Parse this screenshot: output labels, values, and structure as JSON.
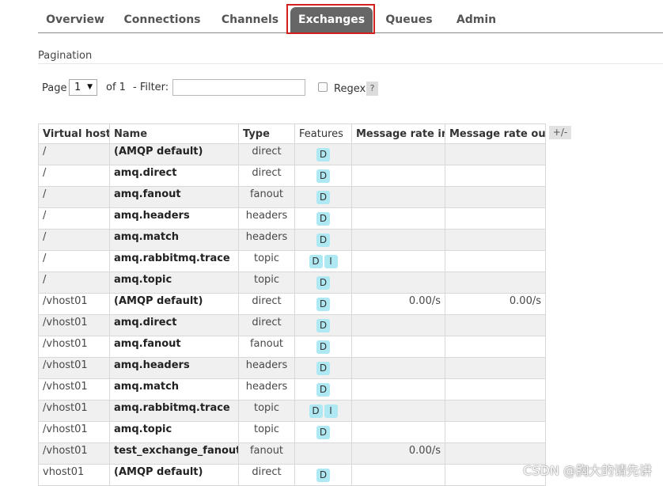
{
  "nav": {
    "tabs": [
      {
        "label": "Overview"
      },
      {
        "label": "Connections"
      },
      {
        "label": "Channels"
      },
      {
        "label": "Exchanges",
        "active": true
      },
      {
        "label": "Queues"
      },
      {
        "label": "Admin"
      }
    ]
  },
  "pagination": {
    "title": "Pagination",
    "page_label": "Page",
    "page_value": "1",
    "of_label": "of 1",
    "filter_label": "- Filter:",
    "filter_value": "",
    "regex_label": "Regex",
    "help_label": "?"
  },
  "table": {
    "headers": [
      "Virtual host",
      "Name",
      "Type",
      "Features",
      "Message rate in",
      "Message rate out"
    ],
    "toggle_label": "+/-",
    "rows": [
      {
        "vhost": "/",
        "name": "(AMQP default)",
        "type": "direct",
        "features": [
          "D"
        ],
        "rate_in": "",
        "rate_out": ""
      },
      {
        "vhost": "/",
        "name": "amq.direct",
        "type": "direct",
        "features": [
          "D"
        ],
        "rate_in": "",
        "rate_out": ""
      },
      {
        "vhost": "/",
        "name": "amq.fanout",
        "type": "fanout",
        "features": [
          "D"
        ],
        "rate_in": "",
        "rate_out": ""
      },
      {
        "vhost": "/",
        "name": "amq.headers",
        "type": "headers",
        "features": [
          "D"
        ],
        "rate_in": "",
        "rate_out": ""
      },
      {
        "vhost": "/",
        "name": "amq.match",
        "type": "headers",
        "features": [
          "D"
        ],
        "rate_in": "",
        "rate_out": ""
      },
      {
        "vhost": "/",
        "name": "amq.rabbitmq.trace",
        "type": "topic",
        "features": [
          "D",
          "I"
        ],
        "rate_in": "",
        "rate_out": ""
      },
      {
        "vhost": "/",
        "name": "amq.topic",
        "type": "topic",
        "features": [
          "D"
        ],
        "rate_in": "",
        "rate_out": ""
      },
      {
        "vhost": "/vhost01",
        "name": "(AMQP default)",
        "type": "direct",
        "features": [
          "D"
        ],
        "rate_in": "0.00/s",
        "rate_out": "0.00/s"
      },
      {
        "vhost": "/vhost01",
        "name": "amq.direct",
        "type": "direct",
        "features": [
          "D"
        ],
        "rate_in": "",
        "rate_out": ""
      },
      {
        "vhost": "/vhost01",
        "name": "amq.fanout",
        "type": "fanout",
        "features": [
          "D"
        ],
        "rate_in": "",
        "rate_out": ""
      },
      {
        "vhost": "/vhost01",
        "name": "amq.headers",
        "type": "headers",
        "features": [
          "D"
        ],
        "rate_in": "",
        "rate_out": ""
      },
      {
        "vhost": "/vhost01",
        "name": "amq.match",
        "type": "headers",
        "features": [
          "D"
        ],
        "rate_in": "",
        "rate_out": ""
      },
      {
        "vhost": "/vhost01",
        "name": "amq.rabbitmq.trace",
        "type": "topic",
        "features": [
          "D",
          "I"
        ],
        "rate_in": "",
        "rate_out": ""
      },
      {
        "vhost": "/vhost01",
        "name": "amq.topic",
        "type": "topic",
        "features": [
          "D"
        ],
        "rate_in": "",
        "rate_out": ""
      },
      {
        "vhost": "/vhost01",
        "name": "test_exchange_fanout",
        "type": "fanout",
        "features": [],
        "rate_in": "0.00/s",
        "rate_out": ""
      },
      {
        "vhost": "vhost01",
        "name": "(AMQP default)",
        "type": "direct",
        "features": [
          "D"
        ],
        "rate_in": "",
        "rate_out": ""
      }
    ]
  },
  "watermark": "CSDN @胸大的请先讲",
  "colors": {
    "active_tab": "#666666",
    "highlight_box": "#d22020",
    "feature_badge": "#aee8f2"
  }
}
